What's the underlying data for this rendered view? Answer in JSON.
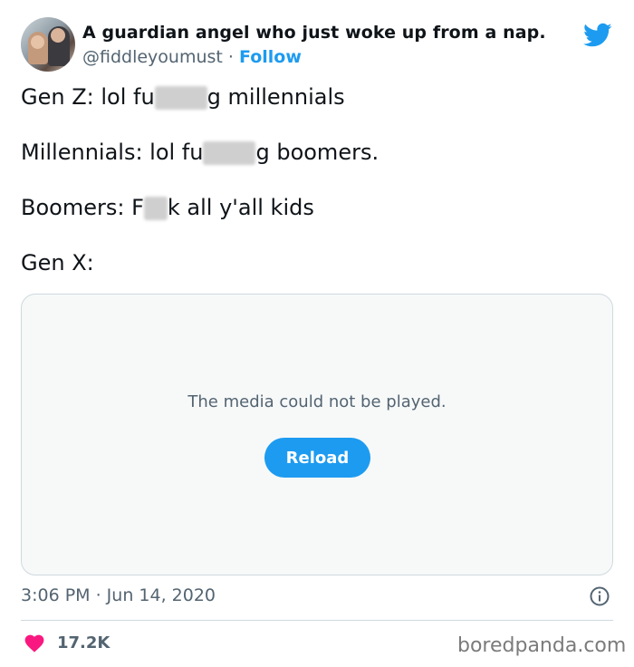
{
  "author": {
    "display_name": "A guardian angel who just woke up from a nap.",
    "handle": "@fiddleyoumust",
    "separator": "·",
    "follow_label": "Follow"
  },
  "icons": {
    "brand": "twitter-bird-icon",
    "info": "info-icon",
    "like": "heart-icon"
  },
  "tweet": {
    "lines": [
      {
        "before": "Gen Z: lol fu",
        "after": "g millennials"
      },
      {
        "before": "Millennials: lol fu",
        "after": "g boomers."
      },
      {
        "before": "Boomers: F",
        "after": "k all y'all kids"
      },
      {
        "before": "Gen X:",
        "after": ""
      }
    ]
  },
  "media": {
    "message": "The media could not be played.",
    "reload_label": "Reload"
  },
  "timestamp": "3:06 PM · Jun 14, 2020",
  "likes": "17.2K",
  "watermark": "boredpanda.com",
  "colors": {
    "accent": "#1d9bf0",
    "like": "#f91880",
    "muted_text": "#536471"
  }
}
